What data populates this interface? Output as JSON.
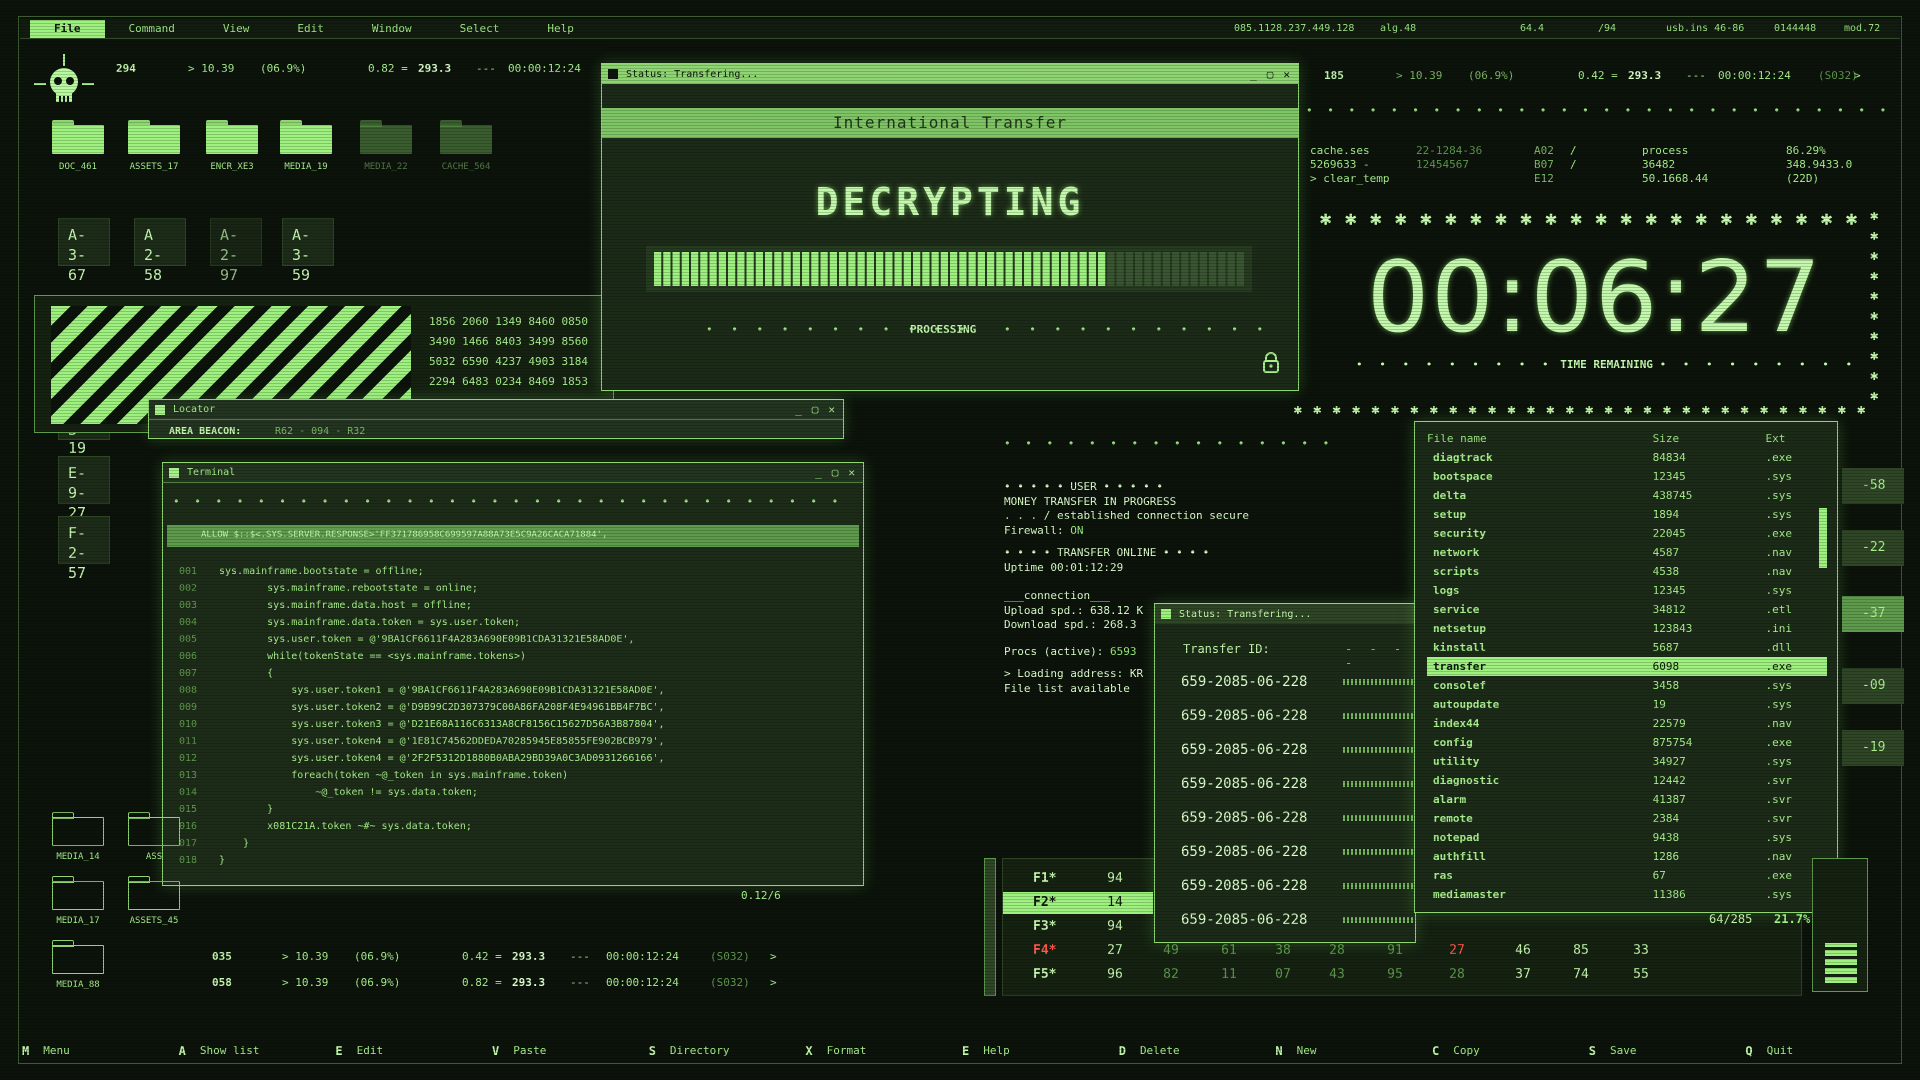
{
  "menu": {
    "items": [
      "File",
      "Command",
      "View",
      "Edit",
      "Window",
      "Select",
      "Help"
    ],
    "status": [
      "085.1128.237.449.128",
      "alg.48",
      "64.4",
      "/94",
      "usb.ins 46-86",
      "0144448",
      "mod.72"
    ]
  },
  "colors": {
    "accent": "#9ef07f",
    "text": "#a8f08c",
    "background": "#0c130b",
    "warning": "#ff5b4a"
  },
  "topstats": {
    "count": "294",
    "v1": "> 10.39",
    "v2": "(06.9%)",
    "v3": "0.82 =",
    "v4": "293.3",
    "v5": "---",
    "time": "00:00:12:24"
  },
  "topstats_right": {
    "count": "185",
    "v1": "> 10.39",
    "v2": "(06.9%)",
    "v3": "0.42 =",
    "v4": "293.3",
    "v5": "---",
    "time": "00:00:12:24",
    "code": "(S032)",
    "arrow": ">"
  },
  "folders": [
    "DOC_461",
    "ASSETS_17",
    "ENCR_XE3",
    "MEDIA_19",
    "MEDIA_22",
    "CACHE_564"
  ],
  "tiles": [
    {
      "top": "A-",
      "bot": "3-67"
    },
    {
      "top": "A",
      "bot": "2-58"
    },
    {
      "top": "A-",
      "bot": "2-97"
    },
    {
      "top": "A-",
      "bot": "3-59"
    },
    {
      "top": "E-",
      "bot": "9-27"
    },
    {
      "top": "F-",
      "bot": "2-57"
    }
  ],
  "tile_partial": "3-19",
  "numgrid": [
    "1856 2060 1349 8460 0850",
    "3490 1466 8403 3499 8560",
    "5032 6590 4237 4903 3184",
    "2294 6483 0234 8469 1853"
  ],
  "decrypt": {
    "window_title": "Status: Transfering...",
    "header": "International Transfer",
    "heading": "DECRYPTING",
    "progress": 0.76,
    "processing": "PROCESSING"
  },
  "cache": {
    "c1": [
      "cache.ses",
      "5269633 -",
      "> clear_temp"
    ],
    "c2": [
      "22-1284-36",
      "12454567",
      ""
    ],
    "c3": [
      "A02",
      "B07",
      "E12"
    ],
    "c4": [
      "/",
      "/",
      ""
    ],
    "c5": [
      "process",
      "36482",
      "50.1668.44"
    ],
    "c6": [
      "86.29%",
      "348.9433.0",
      "(22D)"
    ]
  },
  "timer": {
    "value": "00:06:27",
    "label": "TIME REMAINING"
  },
  "locator": {
    "title": "Locator",
    "beacon": "AREA BEACON:",
    "beacon_vals": "R62 - 094 - R32",
    "zoom": "0.12/6"
  },
  "terminal": {
    "title": "Terminal",
    "allow": "ALLOW $::$<.SYS.SERVER.RESPONSE>'FF371786958C699597A88A73E5C9A26CACA71884',",
    "lines": [
      {
        "n": "001",
        "t": "sys.mainframe.bootstate = offline;"
      },
      {
        "n": "002",
        "t": "        sys.mainframe.rebootstate = online;"
      },
      {
        "n": "003",
        "t": "        sys.mainframe.data.host = offline;"
      },
      {
        "n": "004",
        "t": "        sys.mainframe.data.token = sys.user.token;"
      },
      {
        "n": "005",
        "t": "        sys.user.token = @'9BA1CF6611F4A283A690E09B1CDA31321E58AD0E',"
      },
      {
        "n": "006",
        "t": "        while(tokenState == <sys.mainframe.tokens>)"
      },
      {
        "n": "007",
        "t": "        {"
      },
      {
        "n": "008",
        "t": "            sys.user.token1 = @'9BA1CF6611F4A283A690E09B1CDA31321E58AD0E',"
      },
      {
        "n": "009",
        "t": "            sys.user.token2 = @'D9B99C2D307379C00A86FA208F4E94961BB4F7BC',"
      },
      {
        "n": "010",
        "t": "            sys.user.token3 = @'D21E68A116C6313A8CF8156C15627D56A3B87804',"
      },
      {
        "n": "011",
        "t": "            sys.user.token4 = @'1E81C74562DDEDA70285945E85855FE902BCB979',"
      },
      {
        "n": "012",
        "t": "            sys.user.token4 = @'2F2F5312D1880B0ABA29BD39A0C3AD0931266166',"
      },
      {
        "n": "013",
        "t": "            foreach(token ~@_token in sys.mainframe.token)"
      },
      {
        "n": "014",
        "t": "                ~@_token != sys.data.token;"
      },
      {
        "n": "015",
        "t": "        }"
      },
      {
        "n": "016",
        "t": "        x081C21A.token ~#~ sys.data.token;"
      },
      {
        "n": "017",
        "t": "    }"
      },
      {
        "n": "018",
        "t": "}"
      }
    ]
  },
  "userinfo": {
    "l1": "• • • • •  USER  • • • • •",
    "l2": "MONEY TRANSFER IN PROGRESS",
    "l3": ". . . / established connection secure",
    "l4a": "Firewall:",
    "l4b": "ON",
    "l5": "• • • • TRANSFER ONLINE • • • •",
    "l6": "Uptime 00:01:12:29",
    "l7": "___connection___",
    "l8": "Upload spd.: 638.12 K",
    "l9": "Download spd.: 268.3",
    "l10a": "Procs (active):",
    "l10b": "6593",
    "l11": "> Loading address: KR",
    "l12": "File list available"
  },
  "transfer2": {
    "title": "Status: Transfering...",
    "header": "Transfer ID:",
    "ids": [
      "659-2085-06-228",
      "659-2085-06-228",
      "659-2085-06-228",
      "659-2085-06-228",
      "659-2085-06-228",
      "659-2085-06-228",
      "659-2085-06-228",
      "659-2085-06-228"
    ]
  },
  "filelist": {
    "headers": [
      "File name",
      "Size",
      "Ext"
    ],
    "rows": [
      [
        "diagtrack",
        "84834",
        ".exe"
      ],
      [
        "bootspace",
        "12345",
        ".sys"
      ],
      [
        "delta",
        "438745",
        ".sys"
      ],
      [
        "setup",
        "1894",
        ".sys"
      ],
      [
        "security",
        "22045",
        ".exe"
      ],
      [
        "network",
        "4587",
        ".nav"
      ],
      [
        "scripts",
        "4538",
        ".nav"
      ],
      [
        "logs",
        "12345",
        ".sys"
      ],
      [
        "service",
        "34812",
        ".etl"
      ],
      [
        "netsetup",
        "123843",
        ".ini"
      ],
      [
        "kinstall",
        "5687",
        ".dll"
      ],
      [
        "transfer",
        "6098",
        ".exe"
      ],
      [
        "consolef",
        "3458",
        ".sys"
      ],
      [
        "autoupdate",
        "19",
        ".sys"
      ],
      [
        "index44",
        "22579",
        ".nav"
      ],
      [
        "config",
        "875754",
        ".exe"
      ],
      [
        "utility",
        "34927",
        ".sys"
      ],
      [
        "diagnostic",
        "12442",
        ".svr"
      ],
      [
        "alarm",
        "41387",
        ".svr"
      ],
      [
        "remote",
        "2384",
        ".svr"
      ],
      [
        "notepad",
        "9438",
        ".sys"
      ],
      [
        "authfill",
        "1286",
        ".nav"
      ],
      [
        "ras",
        "67",
        ".exe"
      ],
      [
        "mediamaster",
        "11386",
        ".sys"
      ]
    ],
    "selected": 11,
    "count": "64/285",
    "pct": "21.7%"
  },
  "sidetiles": [
    "-58",
    "-22",
    "-37",
    "-09",
    "-19"
  ],
  "fkeys": {
    "rows": [
      {
        "k": "F1*",
        "v": [
          "94"
        ]
      },
      {
        "k": "F2*",
        "v": [
          "14"
        ]
      },
      {
        "k": "F3*",
        "v": [
          "94"
        ]
      },
      {
        "k": "F4*",
        "v": [
          "27",
          "49",
          "61",
          "38",
          "28",
          "91",
          "27",
          "46",
          "85",
          "33"
        ]
      },
      {
        "k": "F5*",
        "v": [
          "96",
          "82",
          "11",
          "07",
          "43",
          "95",
          "28",
          "37",
          "74",
          "55"
        ]
      }
    ]
  },
  "bottomstats": [
    {
      "count": "035",
      "v1": "> 10.39",
      "v2": "(06.9%)",
      "v3": "0.42 =",
      "v4": "293.3",
      "v5": "---",
      "time": "00:00:12:24",
      "code": "(S032)",
      "arrow": ">"
    },
    {
      "count": "058",
      "v1": "> 10.39",
      "v2": "(06.9%)",
      "v3": "0.82 =",
      "v4": "293.3",
      "v5": "---",
      "time": "00:00:12:24",
      "code": "(S032)",
      "arrow": ">"
    }
  ],
  "lowerfolders": [
    "MEDIA_14",
    "ASS",
    "MEDIA_17",
    "ASSETS_45",
    "MEDIA_88"
  ],
  "bottombar": [
    {
      "key": "M",
      "label": "Menu"
    },
    {
      "key": "A",
      "label": "Show list"
    },
    {
      "key": "E",
      "label": "Edit"
    },
    {
      "key": "V",
      "label": "Paste"
    },
    {
      "key": "S",
      "label": "Directory"
    },
    {
      "key": "X",
      "label": "Format"
    },
    {
      "key": "E",
      "label": "Help"
    },
    {
      "key": "D",
      "label": "Delete"
    },
    {
      "key": "N",
      "label": "New"
    },
    {
      "key": "C",
      "label": "Copy"
    },
    {
      "key": "S",
      "label": "Save"
    },
    {
      "key": "Q",
      "label": "Quit"
    }
  ]
}
